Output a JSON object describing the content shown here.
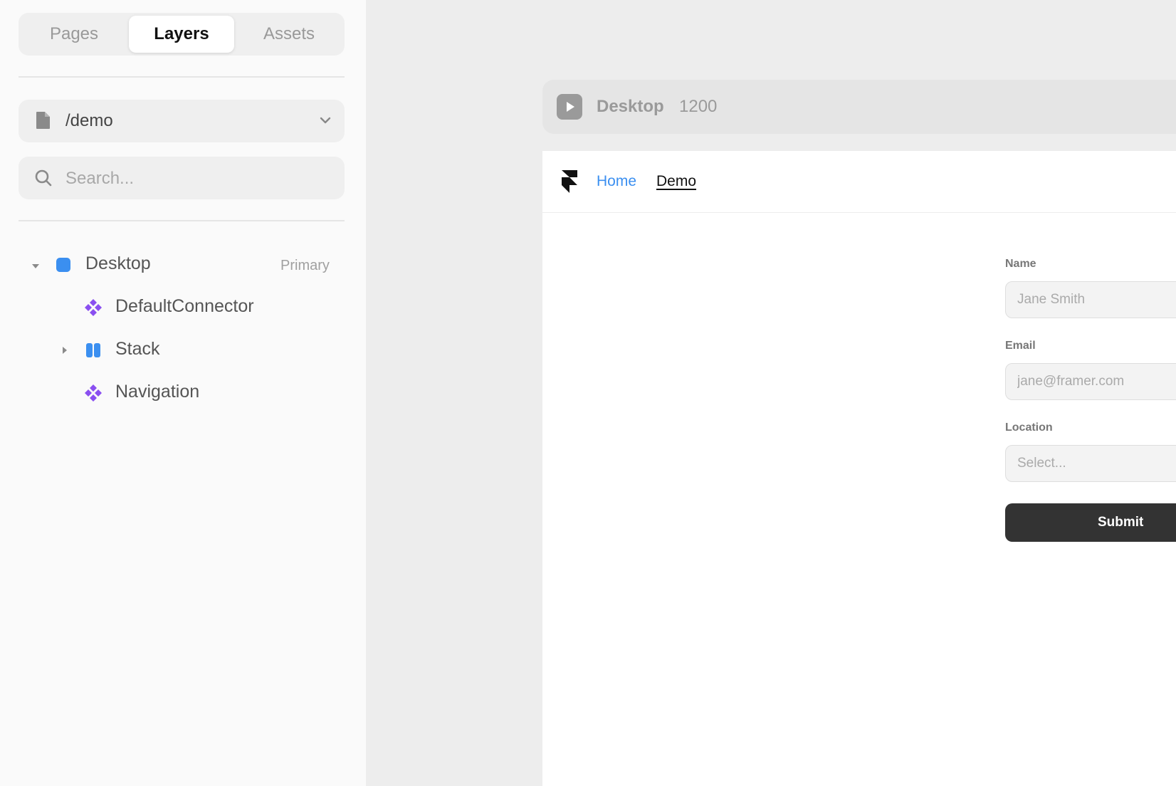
{
  "sidebar": {
    "tabs": [
      {
        "label": "Pages",
        "active": false
      },
      {
        "label": "Layers",
        "active": true
      },
      {
        "label": "Assets",
        "active": false
      }
    ],
    "page_selector": {
      "value": "/demo",
      "icon": "file-icon"
    },
    "search": {
      "placeholder": "Search..."
    },
    "layers": [
      {
        "name": "Desktop",
        "tag": "Primary",
        "icon": "frame-icon",
        "expanded": true
      },
      {
        "name": "DefaultConnector",
        "icon": "component-icon"
      },
      {
        "name": "Stack",
        "icon": "stack-icon",
        "expanded": false
      },
      {
        "name": "Navigation",
        "icon": "component-icon"
      }
    ]
  },
  "canvas": {
    "frame_title": "Desktop",
    "frame_width": "1200",
    "nav": {
      "home": "Home",
      "demo": "Demo"
    },
    "form": {
      "name_label": "Name",
      "name_placeholder": "Jane Smith",
      "email_label": "Email",
      "email_placeholder": "jane@framer.com",
      "location_label": "Location",
      "location_placeholder": "Select...",
      "submit_label": "Submit"
    }
  },
  "colors": {
    "accent_blue": "#3b8ff0",
    "component_purple": "#8a4ff0",
    "button_dark": "#333333"
  }
}
